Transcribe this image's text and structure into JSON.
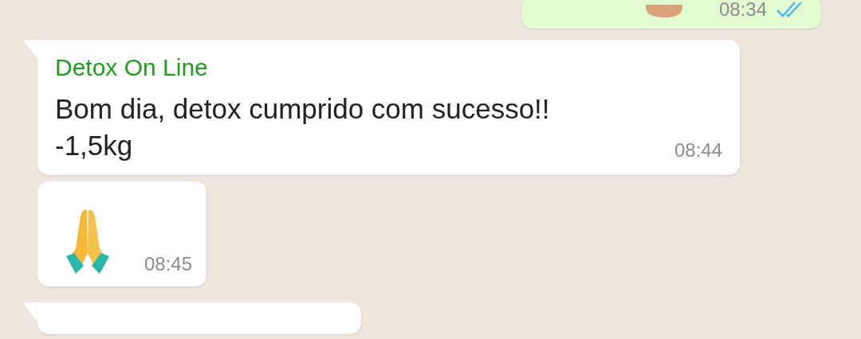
{
  "messages": [
    {
      "kind": "emoji",
      "outgoing": true,
      "time": "08:34",
      "read": true
    },
    {
      "kind": "text",
      "outgoing": false,
      "sender": "Detox On Line",
      "lines": [
        "Bom dia, detox cumprido com sucesso!!",
        "-1,5kg"
      ],
      "time": "08:44",
      "tail": true
    },
    {
      "kind": "emoji",
      "outgoing": false,
      "time": "08:45",
      "tail": false
    },
    {
      "kind": "text",
      "outgoing": false,
      "tail": true
    }
  ]
}
